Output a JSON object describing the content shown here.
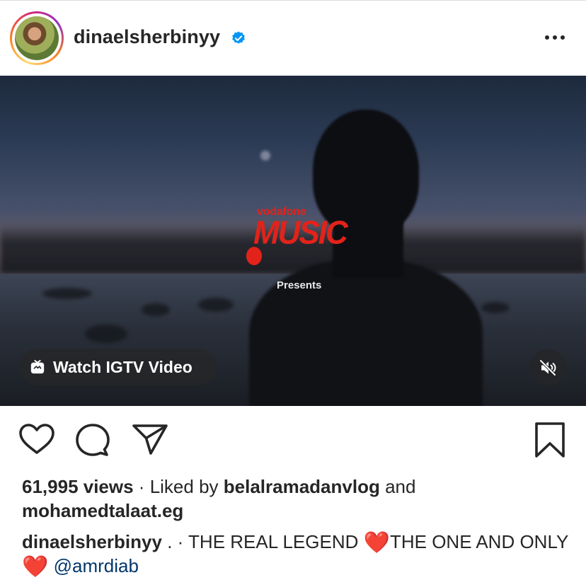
{
  "post": {
    "username": "dinaelsherbinyy",
    "verified_icon": "verified-badge-icon",
    "more_icon": "more-options-icon"
  },
  "media": {
    "brand_small": "vodafone",
    "brand_big": "MUSIC",
    "presents": "Presents",
    "igtv_label": "Watch IGTV Video",
    "igtv_icon": "igtv-icon",
    "mute_icon": "muted-speaker-icon"
  },
  "actions": {
    "like_icon": "heart-icon",
    "comment_icon": "comment-icon",
    "share_icon": "paper-plane-icon",
    "save_icon": "bookmark-icon"
  },
  "stats": {
    "views": "61,995 views",
    "separator": " · ",
    "liked_by": "Liked by ",
    "liker1": "belalramadanvlog",
    "and": " and",
    "liker2": "mohamedtalaat.eg"
  },
  "caption": {
    "author": "dinaelsherbinyy",
    "text1": " . · THE REAL LEGEND ",
    "heart1": "❤️",
    "text2": "THE ONE AND ONLY ",
    "heart2": "❤️",
    "mention": "@amrdiab"
  },
  "colors": {
    "accent_blue": "#0095f6",
    "vodafone_red": "#e2231a",
    "mention": "#00376b"
  }
}
